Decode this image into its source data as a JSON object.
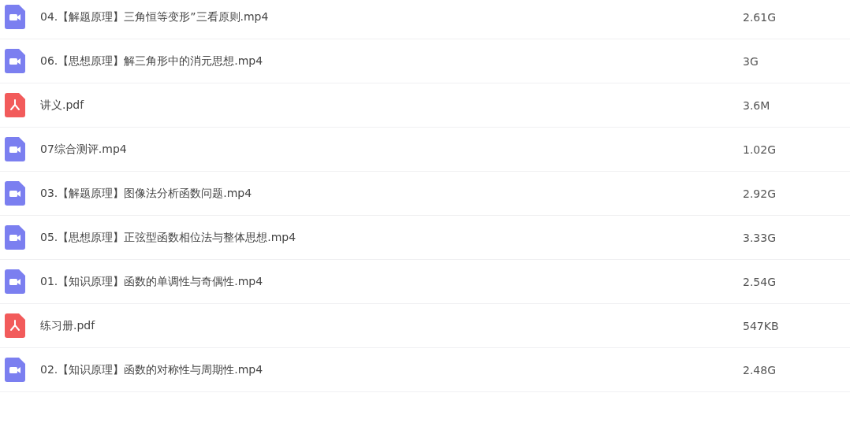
{
  "files": [
    {
      "kind": "video",
      "name": "04.【解题原理】三角恒等变形”三看原则.mp4",
      "size": "2.61G"
    },
    {
      "kind": "video",
      "name": "06.【思想原理】解三角形中的消元思想.mp4",
      "size": "3G"
    },
    {
      "kind": "pdf",
      "name": "讲义.pdf",
      "size": "3.6M"
    },
    {
      "kind": "video",
      "name": "07综合测评.mp4",
      "size": "1.02G"
    },
    {
      "kind": "video",
      "name": "03.【解题原理】图像法分析函数问题.mp4",
      "size": "2.92G"
    },
    {
      "kind": "video",
      "name": "05.【思想原理】正弦型函数相位法与整体思想.mp4",
      "size": "3.33G"
    },
    {
      "kind": "video",
      "name": "01.【知识原理】函数的单调性与奇偶性.mp4",
      "size": "2.54G"
    },
    {
      "kind": "pdf",
      "name": "练习册.pdf",
      "size": "547KB"
    },
    {
      "kind": "video",
      "name": "02.【知识原理】函数的对称性与周期性.mp4",
      "size": "2.48G"
    }
  ]
}
